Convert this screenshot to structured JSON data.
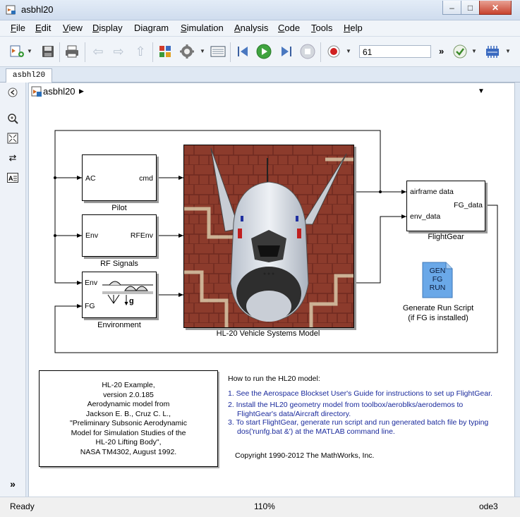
{
  "window": {
    "title": "asbhl20"
  },
  "menubar": [
    {
      "label": "File",
      "ul": "F",
      "rest": "ile"
    },
    {
      "label": "Edit",
      "ul": "E",
      "rest": "dit"
    },
    {
      "label": "View",
      "ul": "V",
      "rest": "iew"
    },
    {
      "label": "Display",
      "ul": "D",
      "rest": "isplay"
    },
    {
      "label": "Diagram",
      "ul": "",
      "rest": "Diagram"
    },
    {
      "label": "Simulation",
      "ul": "S",
      "rest": "imulation"
    },
    {
      "label": "Analysis",
      "ul": "A",
      "rest": "nalysis"
    },
    {
      "label": "Code",
      "ul": "C",
      "rest": "ode"
    },
    {
      "label": "Tools",
      "ul": "T",
      "rest": "ools"
    },
    {
      "label": "Help",
      "ul": "H",
      "rest": "elp"
    }
  ],
  "toolbar": {
    "stop_time": "61"
  },
  "tab": {
    "label": "asbhl20"
  },
  "breadcrumb": {
    "label": "asbhl20"
  },
  "diagram": {
    "pilot": {
      "label": "Pilot",
      "in_port": "AC",
      "out_port": "cmd"
    },
    "rf_signals": {
      "label": "RF Signals",
      "in_port": "Env",
      "out_port": "RFEnv"
    },
    "environment": {
      "label": "Environment",
      "in_port_1": "Env",
      "in_port_2": "FG"
    },
    "vehicle": {
      "label": "HL-20 Vehicle Systems Model"
    },
    "flightgear": {
      "label": "FlightGear",
      "in_port_1": "airframe data",
      "in_port_2": "env_data",
      "out_port": "FG_data"
    },
    "run_script": {
      "icon_line1": "GEN",
      "icon_line2": "FG",
      "icon_line3": "RUN",
      "label_line1": "Generate Run Script",
      "label_line2": "(if FG is installed)"
    },
    "info_box": [
      "HL-20 Example,",
      "version 2.0.185",
      "Aerodynamic model from",
      "Jackson E. B., Cruz C. L.,",
      "\"Preliminary Subsonic Aerodynamic",
      "Model for Simulation Studies of the",
      "HL-20 Lifting Body\",",
      "NASA TM4302, August 1992."
    ],
    "howto": {
      "title": "How to run the HL20 model:",
      "step1": "1. See the Aerospace Blockset User's Guide for instructions to set up FlightGear.",
      "step2a": "2. Install the HL20 geometry model from toolbox/aeroblks/aerodemos to",
      "step2b": "FlightGear's data/Aircraft directory.",
      "step3a": "3. To start FlightGear, generate run script and run generated batch file by typing",
      "step3b": "dos('runfg.bat &') at the MATLAB command line.",
      "copyright": "Copyright 1990-2012 The MathWorks, Inc."
    }
  },
  "status": {
    "left": "Ready",
    "zoom": "110%",
    "solver": "ode3"
  }
}
